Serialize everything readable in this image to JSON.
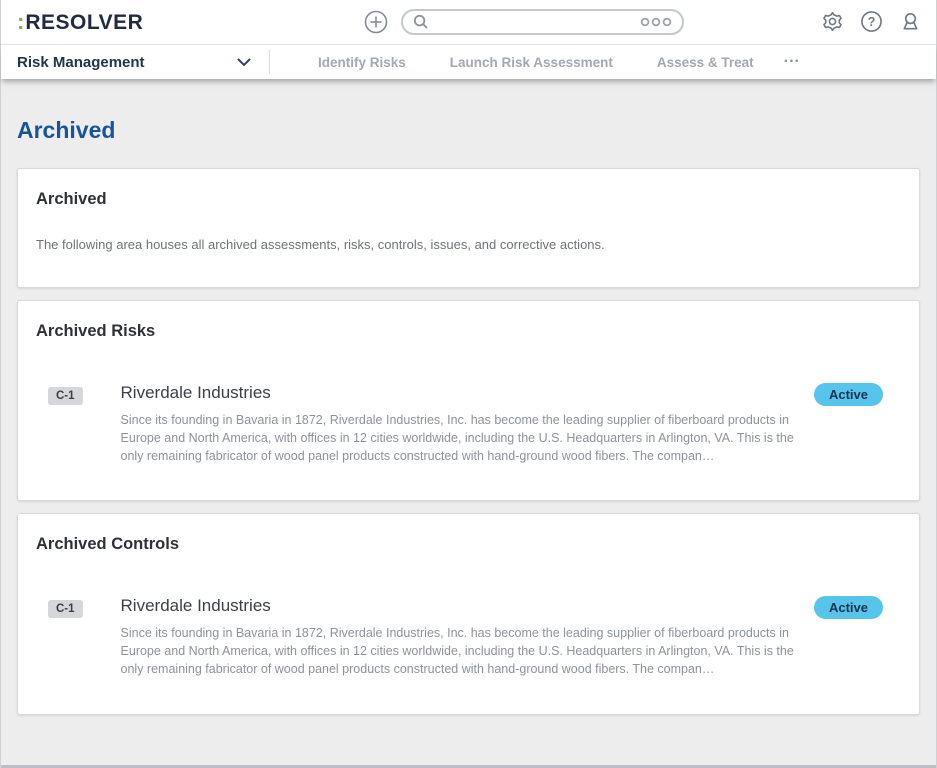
{
  "header": {
    "logo": {
      "colon": ":",
      "word": "RESOLVER"
    },
    "search": {
      "value": "",
      "placeholder": ""
    }
  },
  "nav": {
    "app_selector": "Risk Management",
    "tabs": [
      "Identify Risks",
      "Launch Risk Assessment",
      "Assess & Treat"
    ],
    "more": "..."
  },
  "page": {
    "title": "Archived",
    "cards": [
      {
        "heading": "Archived",
        "description": "The following area houses all archived assessments, risks, controls, issues, and corrective actions."
      },
      {
        "heading": "Archived Risks",
        "item": {
          "id": "C-1",
          "title": "Riverdale Industries",
          "status": "Active",
          "description": "Since its founding in Bavaria in 1872, Riverdale Industries, Inc. has become the leading supplier of fiberboard products in Europe and North America, with offices in 12 cities worldwide, including the U.S. Headquarters in Arlington, VA. This is the only remaining fabricator of wood panel products constructed with hand-ground wood fibers. The compan…"
        }
      },
      {
        "heading": "Archived Controls",
        "item": {
          "id": "C-1",
          "title": "Riverdale Industries",
          "status": "Active",
          "description": "Since its founding in Bavaria in 1872, Riverdale Industries, Inc. has become the leading supplier of fiberboard products in Europe and North America, with offices in 12 cities worldwide, including the U.S. Headquarters in Arlington, VA. This is the only remaining fabricator of wood panel products constructed with hand-ground wood fibers. The compan…"
        }
      }
    ]
  },
  "colors": {
    "brand_green": "#7ab648",
    "brand_navy": "#1e2b40",
    "page_title_blue": "#17549a",
    "status_active_bg": "#57c4ec",
    "status_active_text": "#16344f",
    "id_badge_bg": "#d5d7da"
  }
}
